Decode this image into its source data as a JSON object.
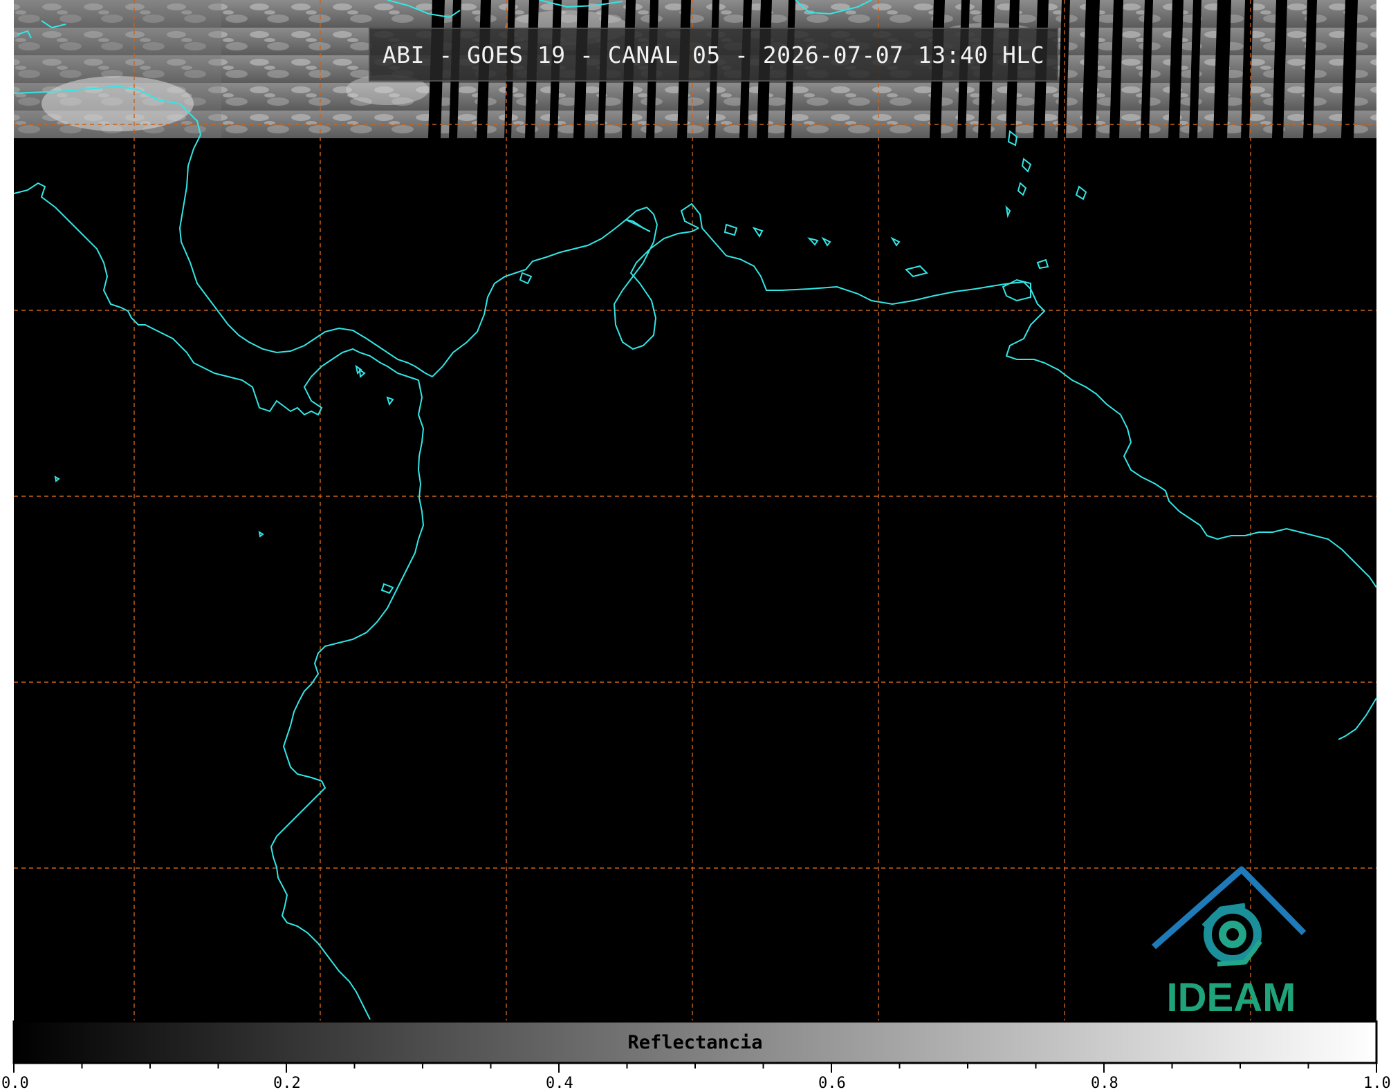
{
  "title": "ABI - GOES 19 - CANAL 05 - 2026-07-07 13:40 HLC",
  "colorbar": {
    "label": "Reflectancia",
    "range": [
      0.0,
      1.0
    ],
    "colormap": "grayscale (black to white)",
    "major_ticks": [
      "0.0",
      "0.2",
      "0.4",
      "0.6",
      "0.8",
      "1.0"
    ]
  },
  "logo": {
    "text": "IDEAM"
  },
  "colors": {
    "coastline": "#33e6e6",
    "gridline": "#c8641e",
    "background": "#000000"
  }
}
